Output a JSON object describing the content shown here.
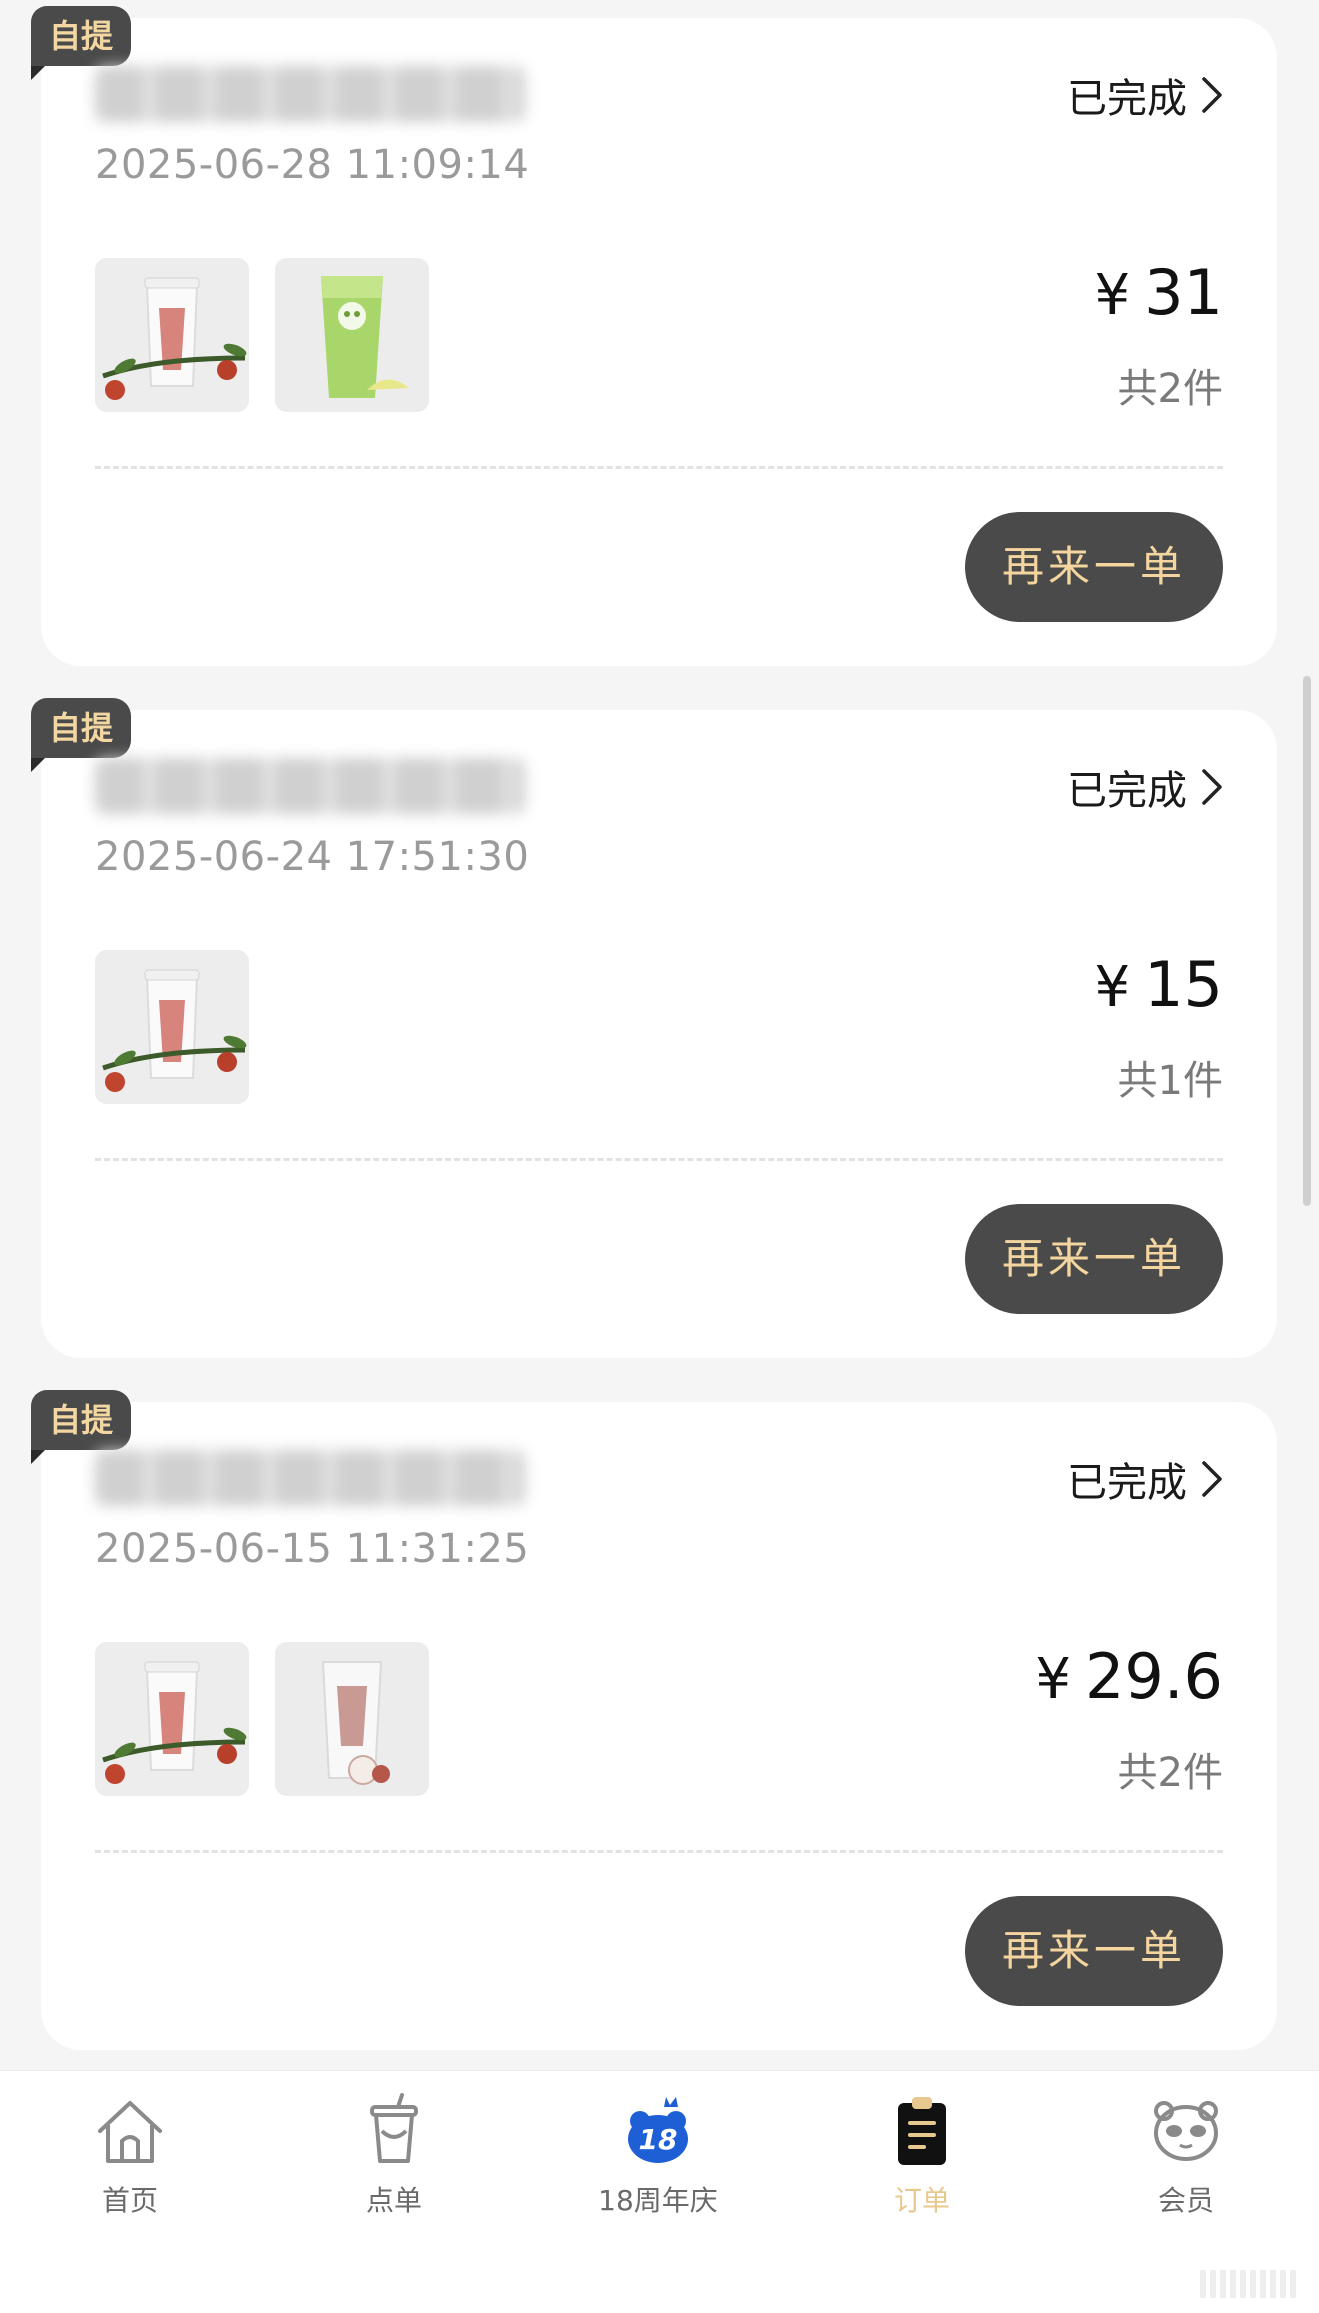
{
  "orders": [
    {
      "tag": "自提",
      "store_name": "",
      "time": "2025-06-28 11:09:14",
      "status": "已完成",
      "currency": "¥",
      "amount": "31",
      "count": "共2件",
      "reorder_label": "再来一单",
      "products": [
        "fruit-tea-cup",
        "green-lime-tea"
      ]
    },
    {
      "tag": "自提",
      "store_name": "",
      "time": "2025-06-24 17:51:30",
      "status": "已完成",
      "currency": "¥",
      "amount": "15",
      "count": "共1件",
      "reorder_label": "再来一单",
      "products": [
        "fruit-tea-cup"
      ]
    },
    {
      "tag": "自提",
      "store_name": "",
      "time": "2025-06-15 11:31:25",
      "status": "已完成",
      "currency": "¥",
      "amount": "29.6",
      "count": "共2件",
      "reorder_label": "再来一单",
      "products": [
        "fruit-tea-cup",
        "lychee-milk-tea"
      ]
    }
  ],
  "tabbar": {
    "items": [
      {
        "label": "首页",
        "icon": "home-icon"
      },
      {
        "label": "点单",
        "icon": "cup-icon"
      },
      {
        "label": "18周年庆",
        "icon": "anniversary-icon"
      },
      {
        "label": "订单",
        "icon": "clipboard-icon"
      },
      {
        "label": "会员",
        "icon": "panda-icon"
      }
    ],
    "active": "订单"
  },
  "colors": {
    "tag_bg": "#4a4a4a",
    "tag_text": "#f3d7a2",
    "button_bg": "#4a4a4a",
    "button_text": "#f4d59f",
    "active_tab": "#e7c98f",
    "anniversary_blue": "#1f5fd6"
  }
}
